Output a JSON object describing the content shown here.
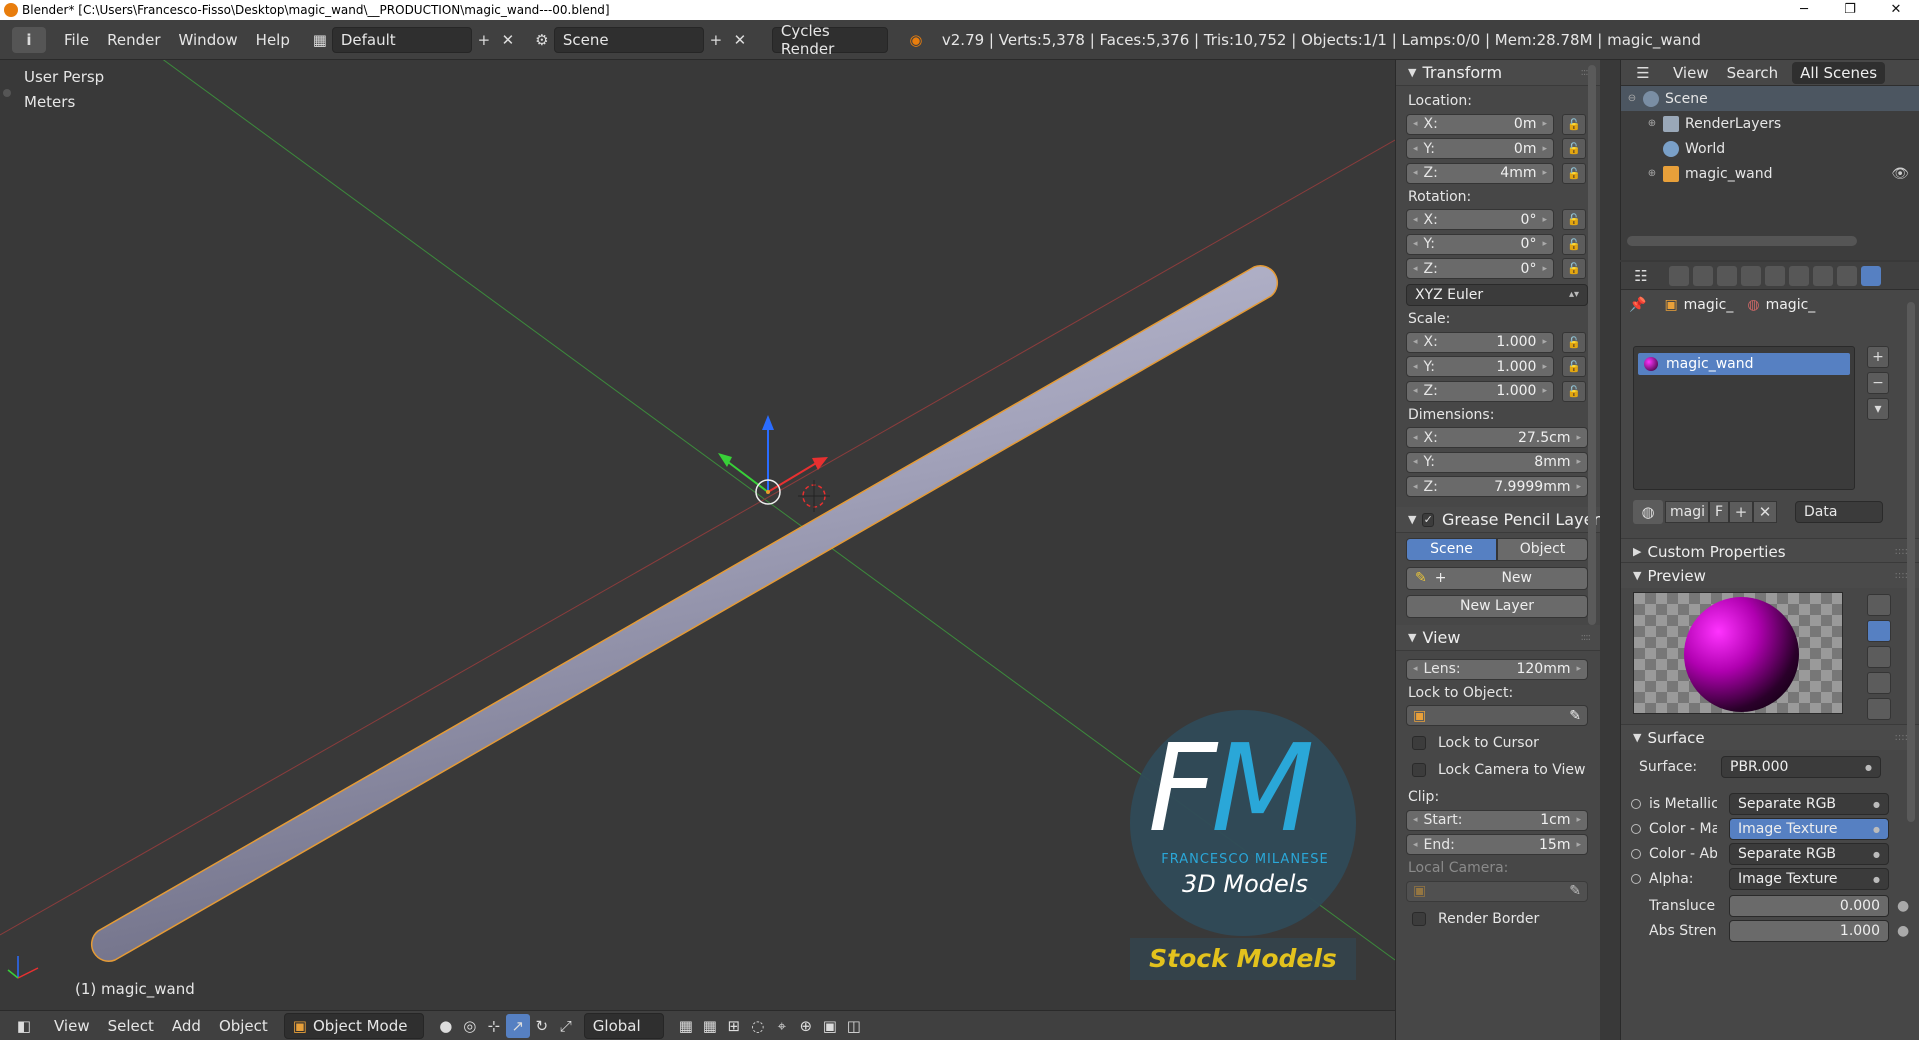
{
  "window": {
    "title": "Blender* [C:\\Users\\Francesco-Fisso\\Desktop\\magic_wand\\__PRODUCTION\\magic_wand---00.blend]",
    "controls": [
      "─",
      "❐",
      "✕"
    ]
  },
  "header": {
    "menus": [
      "File",
      "Render",
      "Window",
      "Help"
    ],
    "screen_layout": "Default",
    "scene": "Scene",
    "render_engine": "Cycles Render",
    "stats": "v2.79 | Verts:5,378 | Faces:5,376 | Tris:10,752 | Objects:1/1 | Lamps:0/0 | Mem:28.78M | magic_wand"
  },
  "viewport": {
    "view_name": "User Persp",
    "units": "Meters",
    "object_label": "(1) magic_wand",
    "watermark": {
      "logo_f": "F",
      "logo_m": "M",
      "author": "FRANCESCO MILANESE",
      "tagline": "3D Models",
      "banner": "Stock Models"
    }
  },
  "bottom_bar": {
    "menus": [
      "View",
      "Select",
      "Add",
      "Object"
    ],
    "mode": "Object Mode",
    "orientation": "Global"
  },
  "transform": {
    "title": "Transform",
    "location_label": "Location:",
    "location": [
      {
        "axis": "X:",
        "value": "0m"
      },
      {
        "axis": "Y:",
        "value": "0m"
      },
      {
        "axis": "Z:",
        "value": "4mm"
      }
    ],
    "rotation_label": "Rotation:",
    "rotation": [
      {
        "axis": "X:",
        "value": "0°"
      },
      {
        "axis": "Y:",
        "value": "0°"
      },
      {
        "axis": "Z:",
        "value": "0°"
      }
    ],
    "rotation_mode": "XYZ Euler",
    "scale_label": "Scale:",
    "scale": [
      {
        "axis": "X:",
        "value": "1.000"
      },
      {
        "axis": "Y:",
        "value": "1.000"
      },
      {
        "axis": "Z:",
        "value": "1.000"
      }
    ],
    "dimensions_label": "Dimensions:",
    "dimensions": [
      {
        "axis": "X:",
        "value": "27.5cm"
      },
      {
        "axis": "Y:",
        "value": "8mm"
      },
      {
        "axis": "Z:",
        "value": "7.9999mm"
      }
    ]
  },
  "grease_pencil": {
    "title": "Grease Pencil Layer",
    "seg_scene": "Scene",
    "seg_object": "Object",
    "new_label": "New",
    "new_layer_label": "New Layer"
  },
  "view_panel": {
    "title": "View",
    "lens_label": "Lens:",
    "lens_value": "120mm",
    "lock_to_object_label": "Lock to Object:",
    "lock_to_cursor": "Lock to Cursor",
    "lock_camera": "Lock Camera to View",
    "clip_label": "Clip:",
    "clip_start_label": "Start:",
    "clip_start": "1cm",
    "clip_end_label": "End:",
    "clip_end": "15m",
    "local_camera_label": "Local Camera:",
    "render_border": "Render Border"
  },
  "outliner": {
    "menus": [
      "View",
      "Search"
    ],
    "filter": "All Scenes",
    "items": [
      {
        "label": "Scene",
        "indent": 0
      },
      {
        "label": "RenderLayers",
        "indent": 1
      },
      {
        "label": "World",
        "indent": 1
      },
      {
        "label": "magic_wand",
        "indent": 1
      }
    ]
  },
  "properties": {
    "crumb_object": "magic_",
    "crumb_material": "magic_",
    "material_slot": "magic_wand",
    "mat_name_short": "magi",
    "fake_user": "F",
    "link": "Data",
    "custom_props": "Custom Properties",
    "preview": "Preview",
    "surface_section": "Surface",
    "surface_label": "Surface:",
    "surface_value": "PBR.000",
    "sockets": [
      {
        "name": "is Metallic",
        "value": "Separate RGB"
      },
      {
        "name": "Color - Ma",
        "value": "Image Texture"
      },
      {
        "name": "Color - Ab",
        "value": "Separate RGB"
      },
      {
        "name": "Alpha:",
        "value": "Image Texture"
      }
    ],
    "sliders": [
      {
        "name": "Transluce",
        "value": "0.000"
      },
      {
        "name": "Abs Stren",
        "value": "1.000"
      }
    ]
  }
}
